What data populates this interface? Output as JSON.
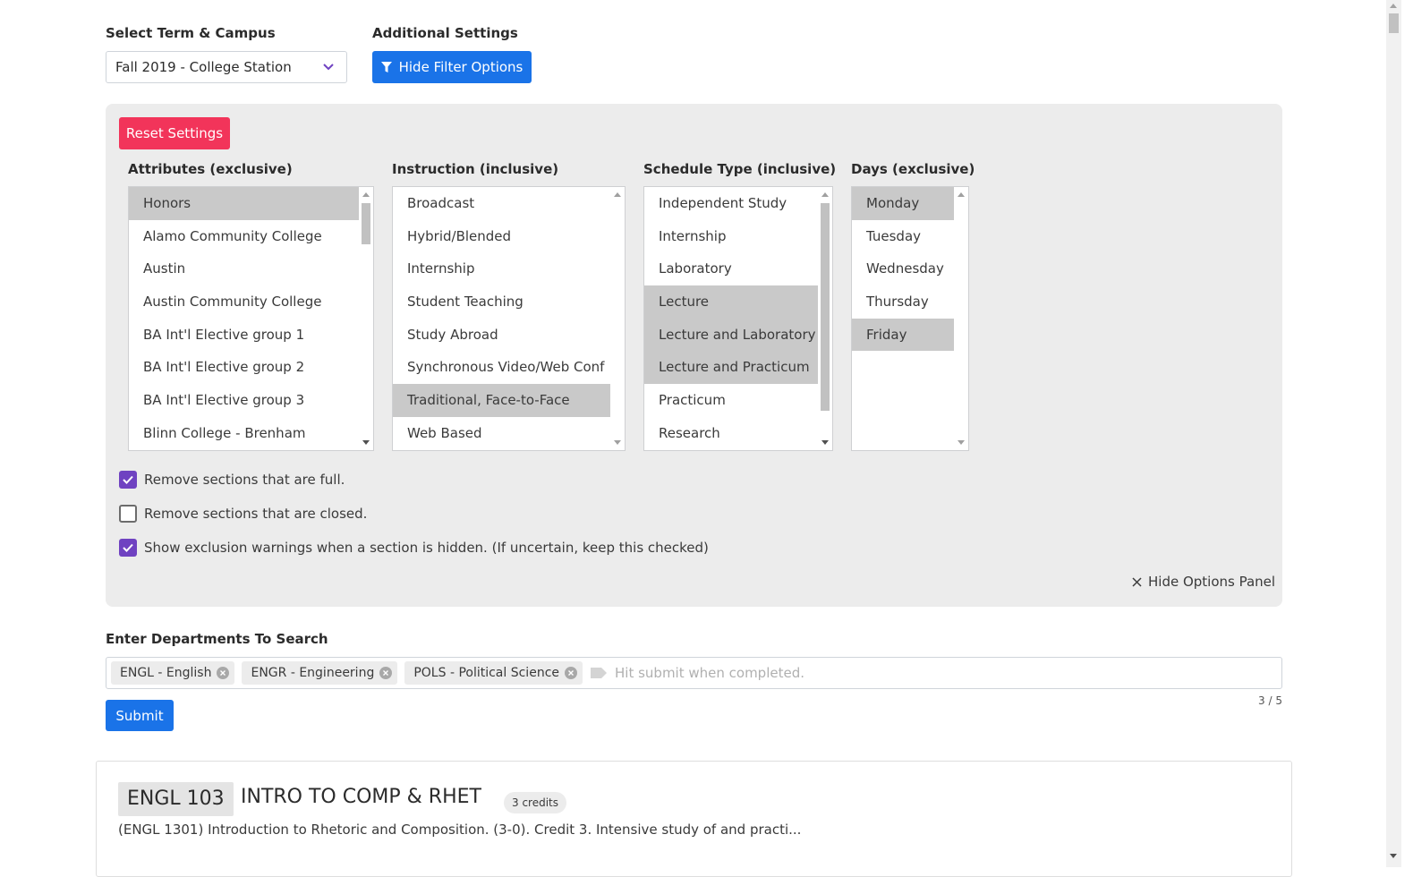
{
  "term": {
    "label": "Select Term & Campus",
    "selected": "Fall 2019 - College Station"
  },
  "additional": {
    "label": "Additional Settings",
    "hide_filter_button": "Hide Filter Options"
  },
  "panel": {
    "reset_button": "Reset Settings",
    "attributes": {
      "label": "Attributes (exclusive)",
      "items": [
        {
          "text": "Honors",
          "selected": true
        },
        {
          "text": "Alamo Community College",
          "selected": false
        },
        {
          "text": "Austin",
          "selected": false
        },
        {
          "text": "Austin Community College",
          "selected": false
        },
        {
          "text": "BA Int'l Elective group 1",
          "selected": false
        },
        {
          "text": "BA Int'l Elective group 2",
          "selected": false
        },
        {
          "text": "BA Int'l Elective group 3",
          "selected": false
        },
        {
          "text": "Blinn College - Brenham",
          "selected": false
        }
      ]
    },
    "instruction": {
      "label": "Instruction (inclusive)",
      "items": [
        {
          "text": "Broadcast",
          "selected": false
        },
        {
          "text": "Hybrid/Blended",
          "selected": false
        },
        {
          "text": "Internship",
          "selected": false
        },
        {
          "text": "Student Teaching",
          "selected": false
        },
        {
          "text": "Study Abroad",
          "selected": false
        },
        {
          "text": "Synchronous Video/Web Conf",
          "selected": false
        },
        {
          "text": "Traditional, Face-to-Face",
          "selected": true
        },
        {
          "text": "Web Based",
          "selected": false
        }
      ]
    },
    "schedule": {
      "label": "Schedule Type (inclusive)",
      "items": [
        {
          "text": "Independent Study",
          "selected": false
        },
        {
          "text": "Internship",
          "selected": false
        },
        {
          "text": "Laboratory",
          "selected": false
        },
        {
          "text": "Lecture",
          "selected": true
        },
        {
          "text": "Lecture and Laboratory",
          "selected": true
        },
        {
          "text": "Lecture and Practicum",
          "selected": true
        },
        {
          "text": "Practicum",
          "selected": false
        },
        {
          "text": "Research",
          "selected": false
        }
      ]
    },
    "days": {
      "label": "Days (exclusive)",
      "items": [
        {
          "text": "Monday",
          "selected": true
        },
        {
          "text": "Tuesday",
          "selected": false
        },
        {
          "text": "Wednesday",
          "selected": false
        },
        {
          "text": "Thursday",
          "selected": false
        },
        {
          "text": "Friday",
          "selected": true
        }
      ]
    },
    "checkboxes": [
      {
        "label": "Remove sections that are full.",
        "checked": true
      },
      {
        "label": "Remove sections that are closed.",
        "checked": false
      },
      {
        "label": "Show exclusion warnings when a section is hidden. (If uncertain, keep this checked)",
        "checked": true
      }
    ],
    "hide_panel": "Hide Options Panel"
  },
  "departments": {
    "label": "Enter Departments To Search",
    "tags": [
      "ENGL - English",
      "ENGR - Engineering",
      "POLS - Political Science"
    ],
    "placeholder": "Hit submit when completed.",
    "counter": "3 / 5",
    "submit": "Submit"
  },
  "course": {
    "code": "ENGL 103",
    "title": "INTRO TO COMP & RHET",
    "credits": "3 credits",
    "description": "(ENGL 1301) Introduction to Rhetoric and Composition. (3-0). Credit 3. Intensive study of and practi..."
  },
  "colors": {
    "primary": "#1a73e8",
    "danger": "#f2345a",
    "checkbox": "#6f42c1",
    "panel_bg": "#ececec",
    "selected_option": "#c9c9c9"
  }
}
